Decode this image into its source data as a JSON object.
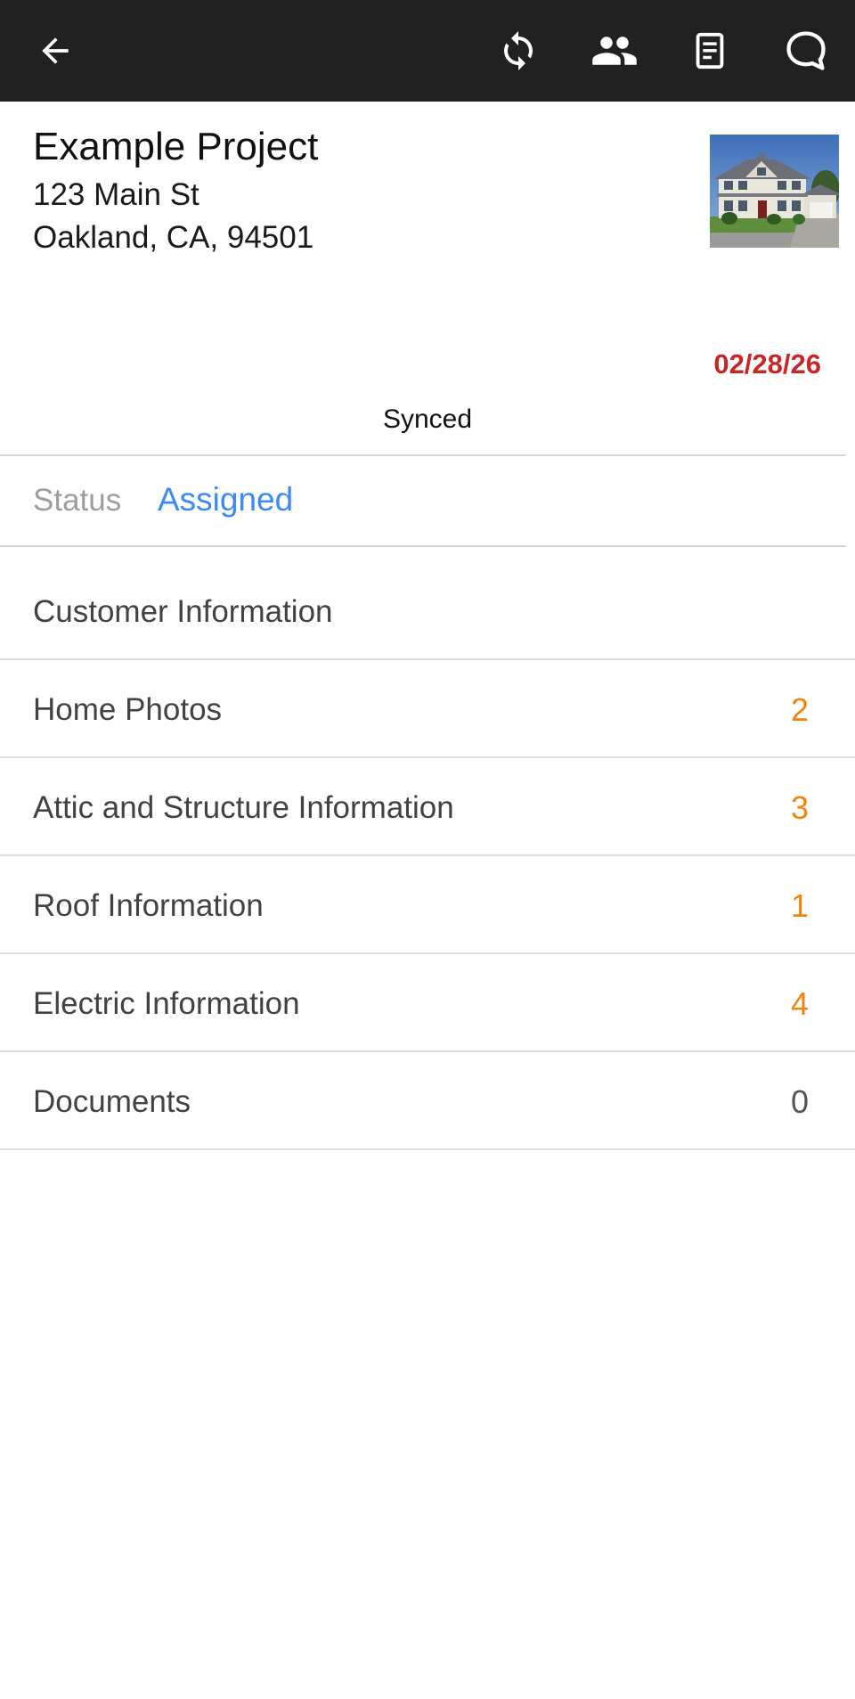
{
  "toolbar": {
    "back_icon": "arrow-left-icon",
    "sync_icon": "sync-icon",
    "people_icon": "people-icon",
    "notes_icon": "document-icon",
    "chat_icon": "chat-bubble-icon",
    "background_color": "#212121"
  },
  "project": {
    "title": "Example Project",
    "address_line1": "123 Main St",
    "address_line2": "Oakland, CA, 94501",
    "thumbnail": "house-photo"
  },
  "due_date": "02/28/26",
  "sync_status": "Synced",
  "status": {
    "label": "Status",
    "value": "Assigned"
  },
  "sections": [
    {
      "label": "Customer Information",
      "count": ""
    },
    {
      "label": "Home Photos",
      "count": "2"
    },
    {
      "label": "Attic and Structure Information",
      "count": "3"
    },
    {
      "label": "Roof Information",
      "count": "1"
    },
    {
      "label": "Electric Information",
      "count": "4"
    },
    {
      "label": "Documents",
      "count": "0"
    }
  ],
  "colors": {
    "accent_blue": "#3d8af7",
    "due_date_red": "#c62828",
    "count_orange": "#f5820d",
    "count_zero_gray": "#555555"
  }
}
